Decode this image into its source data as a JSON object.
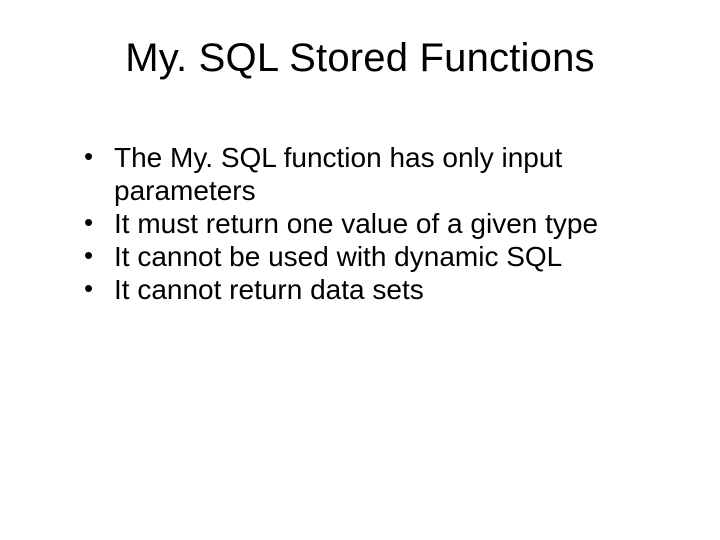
{
  "title": "My. SQL Stored Functions",
  "bullets": [
    "The My. SQL function has only input parameters",
    "It must return one value of a given type",
    "It cannot be used with dynamic SQL",
    "It cannot return data sets"
  ]
}
